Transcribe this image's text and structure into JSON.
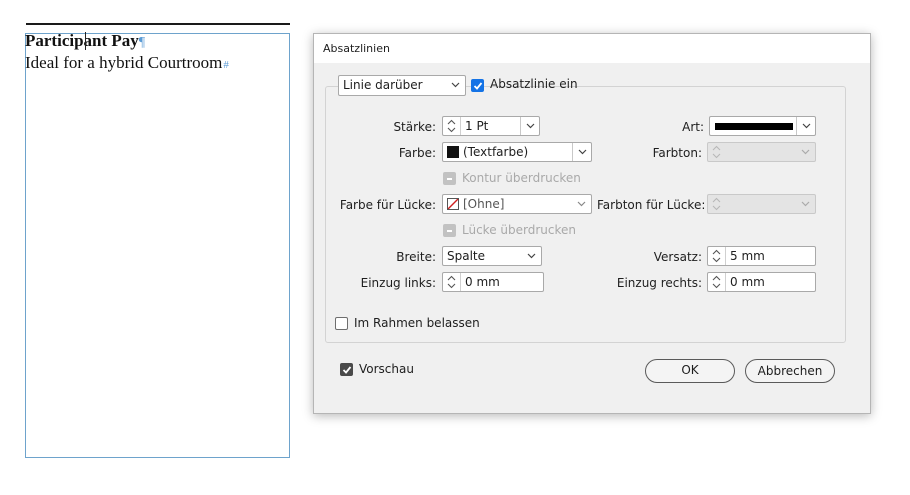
{
  "document": {
    "line1": "Participant Pay",
    "line1_mark": "¶",
    "line2": "Ideal for a hybrid Courtroom",
    "line2_mark": "#"
  },
  "dialog": {
    "title": "Absatzlinien",
    "rule_select": {
      "value": "Linie darüber"
    },
    "rule_on": {
      "label": "Absatzlinie ein",
      "checked": true
    },
    "staerke": {
      "label": "Stärke:",
      "value": "1 Pt"
    },
    "art": {
      "label": "Art:",
      "value": "solid-line"
    },
    "farbe": {
      "label": "Farbe:",
      "value": "(Textfarbe)",
      "swatch": "#111111"
    },
    "farbton": {
      "label": "Farbton:",
      "value": ""
    },
    "kontur": {
      "label": "Kontur überdrucken",
      "enabled": false
    },
    "luecke_farbe": {
      "label": "Farbe für Lücke:",
      "value": "[Ohne]"
    },
    "luecke_farbton": {
      "label": "Farbton für Lücke:",
      "value": ""
    },
    "luecke_ueberdrucken": {
      "label": "Lücke überdrucken",
      "enabled": false
    },
    "breite": {
      "label": "Breite:",
      "value": "Spalte"
    },
    "versatz": {
      "label": "Versatz:",
      "value": "5 mm"
    },
    "einzug_links": {
      "label": "Einzug links:",
      "value": "0 mm"
    },
    "einzug_rechts": {
      "label": "Einzug rechts:",
      "value": "0 mm"
    },
    "im_rahmen": {
      "label": "Im Rahmen belassen",
      "checked": false
    },
    "vorschau": {
      "label": "Vorschau",
      "checked": true
    },
    "ok_label": "OK",
    "cancel_label": "Abbrechen"
  },
  "colors": {
    "frame_border": "#6ea3cc",
    "checkbox_accent": "#1473e6",
    "dialog_bg": "#f0f0f0"
  }
}
